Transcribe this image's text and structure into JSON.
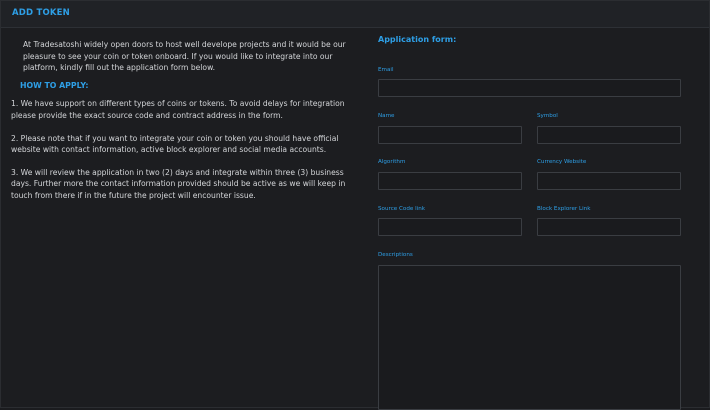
{
  "panel": {
    "title": "ADD TOKEN"
  },
  "info": {
    "intro": "At Tradesatoshi widely open doors to host well develope projects and it would be our pleasure to see your coin or token onboard. If you would like to integrate into our platform, kindly fill out the application form below.",
    "how_to_apply_title": "HOW TO APPLY:",
    "steps": [
      "1. We have support on different types of coins or tokens. To avoid delays for integration please provide the exact source code and contract address in the form.",
      "2. Please note that if you want to integrate your coin or token you should have official website with contact information, active block explorer and social media accounts.",
      "3. We will review the application in two (2) days and integrate within three (3) business days. Further more the contact information provided should be active as we will keep in touch from there if in the future the project will encounter issue."
    ]
  },
  "form": {
    "title": "Application form:",
    "email_label": "Email",
    "email_value": "",
    "name_label": "Name",
    "name_value": "",
    "symbol_label": "Symbol",
    "symbol_value": "",
    "algorithm_label": "Algorithm",
    "algorithm_value": "",
    "currency_website_label": "Currency Website",
    "currency_website_value": "",
    "source_code_label": "Source Code link",
    "source_code_value": "",
    "block_explorer_label": "Block Explorer Link",
    "block_explorer_value": "",
    "descriptions_label": "Descriptions",
    "descriptions_value": ""
  },
  "colors": {
    "accent": "#2e9fe6",
    "background": "#1c1d20",
    "text": "#d4d6d9",
    "input_border": "#3a3d42"
  }
}
